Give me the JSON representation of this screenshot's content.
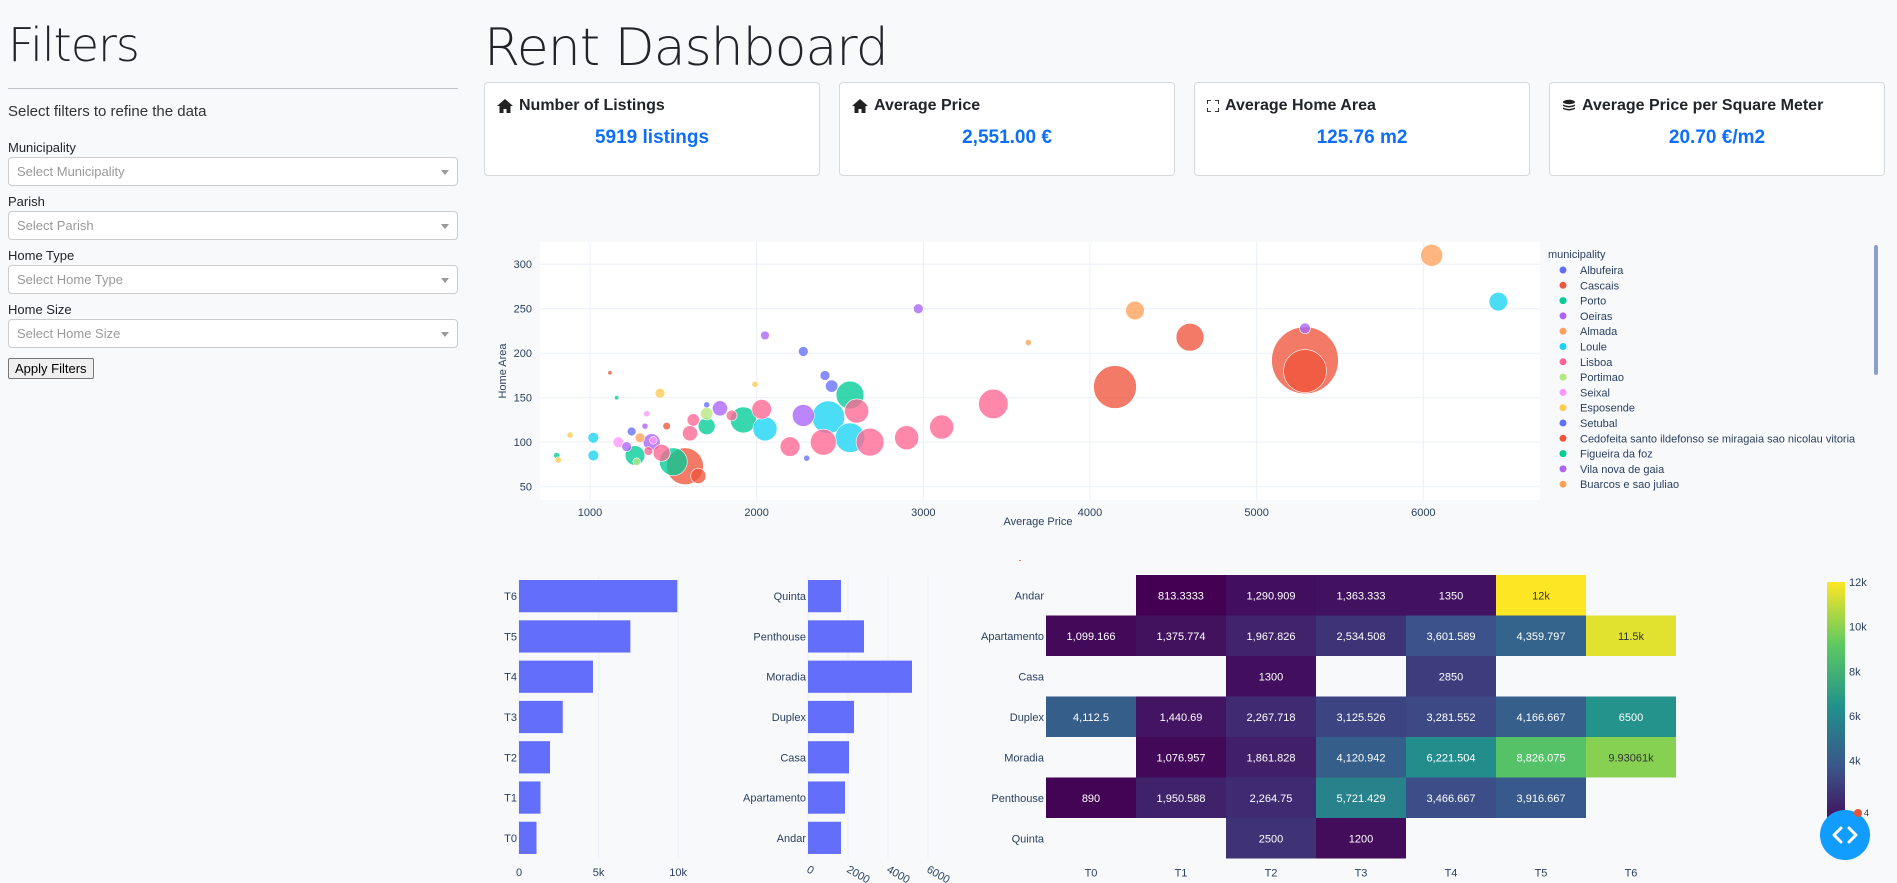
{
  "sidebar": {
    "title": "Filters",
    "subtitle": "Select filters to refine the data",
    "filters": [
      {
        "label": "Municipality",
        "placeholder": "Select Municipality"
      },
      {
        "label": "Parish",
        "placeholder": "Select Parish"
      },
      {
        "label": "Home Type",
        "placeholder": "Select Home Type"
      },
      {
        "label": "Home Size",
        "placeholder": "Select Home Size"
      }
    ],
    "apply_label": "Apply Filters"
  },
  "header": {
    "title": "Rent Dashboard"
  },
  "cards": [
    {
      "title": "Number of Listings",
      "value": "5919 listings",
      "icon": "home-icon"
    },
    {
      "title": "Average Price",
      "value": "2,551.00 €",
      "icon": "home-icon"
    },
    {
      "title": "Average Home Area",
      "value": "125.76 m2",
      "icon": "expand-icon"
    },
    {
      "title": "Average Price per Square Meter",
      "value": "20.70 €/m2",
      "icon": "coins-icon"
    }
  ],
  "colors": {
    "accent": "#0d6efd",
    "bar": "#636efa",
    "fab": "#119dff"
  },
  "chart_data": [
    {
      "type": "scatter",
      "xlabel": "Average Price",
      "ylabel": "Home Area",
      "xlim": [
        700,
        6700
      ],
      "ylim": [
        35,
        325
      ],
      "xticks": [
        1000,
        2000,
        3000,
        4000,
        5000,
        6000
      ],
      "yticks": [
        50,
        100,
        150,
        200,
        250,
        300
      ],
      "legend_title": "municipality",
      "legend_position": "right",
      "legend": [
        {
          "name": "Albufeira",
          "color": "#636efa"
        },
        {
          "name": "Cascais",
          "color": "#ef553b"
        },
        {
          "name": "Porto",
          "color": "#00cc96"
        },
        {
          "name": "Oeiras",
          "color": "#ab63fa"
        },
        {
          "name": "Almada",
          "color": "#ffa15a"
        },
        {
          "name": "Loule",
          "color": "#19d3f3"
        },
        {
          "name": "Lisboa",
          "color": "#ff6692"
        },
        {
          "name": "Portimao",
          "color": "#b6e880"
        },
        {
          "name": "Seixal",
          "color": "#ff97ff"
        },
        {
          "name": "Esposende",
          "color": "#fecb52"
        },
        {
          "name": "Setubal",
          "color": "#636efa"
        },
        {
          "name": "Cedofeita santo ildefonso se miragaia sao nicolau vitoria",
          "color": "#ef553b"
        },
        {
          "name": "Figueira da foz",
          "color": "#00cc96"
        },
        {
          "name": "Vila nova de gaia",
          "color": "#ab63fa"
        },
        {
          "name": "Buarcos e sao juliao",
          "color": "#ffa15a"
        }
      ],
      "points": [
        {
          "x": 5290,
          "y": 192,
          "count": 230,
          "color": "#ef553b"
        },
        {
          "x": 5290,
          "y": 180,
          "count": 95,
          "color": "#ef553b"
        },
        {
          "x": 4150,
          "y": 162,
          "count": 95,
          "color": "#ef553b"
        },
        {
          "x": 4600,
          "y": 218,
          "count": 40,
          "color": "#ef553b"
        },
        {
          "x": 3420,
          "y": 143,
          "count": 45,
          "color": "#ff6692"
        },
        {
          "x": 6050,
          "y": 310,
          "count": 25,
          "color": "#ffa15a"
        },
        {
          "x": 6450,
          "y": 258,
          "count": 18,
          "color": "#19d3f3"
        },
        {
          "x": 4270,
          "y": 248,
          "count": 18,
          "color": "#ffa15a"
        },
        {
          "x": 5290,
          "y": 228,
          "count": 6,
          "color": "#ab63fa"
        },
        {
          "x": 2970,
          "y": 250,
          "count": 5,
          "color": "#ab63fa"
        },
        {
          "x": 3630,
          "y": 212,
          "count": 2,
          "color": "#ffa15a"
        },
        {
          "x": 3110,
          "y": 117,
          "count": 30,
          "color": "#ff6692"
        },
        {
          "x": 2900,
          "y": 105,
          "count": 30,
          "color": "#ff6692"
        },
        {
          "x": 2680,
          "y": 100,
          "count": 40,
          "color": "#ff6692"
        },
        {
          "x": 2560,
          "y": 153,
          "count": 40,
          "color": "#00cc96"
        },
        {
          "x": 2560,
          "y": 105,
          "count": 45,
          "color": "#19d3f3"
        },
        {
          "x": 2430,
          "y": 128,
          "count": 55,
          "color": "#19d3f3"
        },
        {
          "x": 2600,
          "y": 135,
          "count": 30,
          "color": "#ff6692"
        },
        {
          "x": 2400,
          "y": 100,
          "count": 35,
          "color": "#ff6692"
        },
        {
          "x": 2280,
          "y": 130,
          "count": 25,
          "color": "#ab63fa"
        },
        {
          "x": 2200,
          "y": 95,
          "count": 20,
          "color": "#ff6692"
        },
        {
          "x": 2050,
          "y": 115,
          "count": 30,
          "color": "#19d3f3"
        },
        {
          "x": 2030,
          "y": 137,
          "count": 20,
          "color": "#ff6692"
        },
        {
          "x": 1920,
          "y": 125,
          "count": 35,
          "color": "#00cc96"
        },
        {
          "x": 2280,
          "y": 202,
          "count": 5,
          "color": "#636efa"
        },
        {
          "x": 2050,
          "y": 220,
          "count": 4,
          "color": "#ab63fa"
        },
        {
          "x": 2410,
          "y": 175,
          "count": 5,
          "color": "#636efa"
        },
        {
          "x": 2450,
          "y": 163,
          "count": 8,
          "color": "#636efa"
        },
        {
          "x": 1990,
          "y": 165,
          "count": 2,
          "color": "#fecb52"
        },
        {
          "x": 2300,
          "y": 82,
          "count": 2,
          "color": "#636efa"
        },
        {
          "x": 1570,
          "y": 73,
          "count": 70,
          "color": "#ef553b"
        },
        {
          "x": 1500,
          "y": 78,
          "count": 40,
          "color": "#00cc96"
        },
        {
          "x": 1650,
          "y": 62,
          "count": 12,
          "color": "#ef553b"
        },
        {
          "x": 1270,
          "y": 85,
          "count": 20,
          "color": "#00cc96"
        },
        {
          "x": 1370,
          "y": 100,
          "count": 15,
          "color": "#ab63fa"
        },
        {
          "x": 1430,
          "y": 88,
          "count": 15,
          "color": "#ff6692"
        },
        {
          "x": 1600,
          "y": 110,
          "count": 12,
          "color": "#ff6692"
        },
        {
          "x": 1700,
          "y": 118,
          "count": 15,
          "color": "#00cc96"
        },
        {
          "x": 1620,
          "y": 125,
          "count": 8,
          "color": "#ff6692"
        },
        {
          "x": 1780,
          "y": 138,
          "count": 12,
          "color": "#ab63fa"
        },
        {
          "x": 1700,
          "y": 132,
          "count": 8,
          "color": "#b6e880"
        },
        {
          "x": 1850,
          "y": 130,
          "count": 6,
          "color": "#ff6692"
        },
        {
          "x": 1420,
          "y": 155,
          "count": 5,
          "color": "#fecb52"
        },
        {
          "x": 1020,
          "y": 105,
          "count": 6,
          "color": "#19d3f3"
        },
        {
          "x": 1020,
          "y": 85,
          "count": 6,
          "color": "#19d3f3"
        },
        {
          "x": 1170,
          "y": 100,
          "count": 6,
          "color": "#ff97ff"
        },
        {
          "x": 1220,
          "y": 95,
          "count": 5,
          "color": "#ab63fa"
        },
        {
          "x": 1300,
          "y": 105,
          "count": 5,
          "color": "#ffa15a"
        },
        {
          "x": 1350,
          "y": 90,
          "count": 4,
          "color": "#ff6692"
        },
        {
          "x": 1250,
          "y": 112,
          "count": 4,
          "color": "#636efa"
        },
        {
          "x": 1280,
          "y": 78,
          "count": 3,
          "color": "#b6e880"
        },
        {
          "x": 880,
          "y": 108,
          "count": 2,
          "color": "#fecb52"
        },
        {
          "x": 800,
          "y": 85,
          "count": 2,
          "color": "#00cc96"
        },
        {
          "x": 810,
          "y": 80,
          "count": 2,
          "color": "#fecb52"
        },
        {
          "x": 1120,
          "y": 178,
          "count": 1,
          "color": "#ef553b"
        },
        {
          "x": 1160,
          "y": 150,
          "count": 1,
          "color": "#00cc96"
        },
        {
          "x": 1340,
          "y": 132,
          "count": 2,
          "color": "#ff97ff"
        },
        {
          "x": 1330,
          "y": 118,
          "count": 2,
          "color": "#ab63fa"
        },
        {
          "x": 1460,
          "y": 118,
          "count": 3,
          "color": "#ef553b"
        },
        {
          "x": 1380,
          "y": 102,
          "count": 3,
          "color": "#ff97ff"
        },
        {
          "x": 1700,
          "y": 142,
          "count": 2,
          "color": "#636efa"
        }
      ]
    },
    {
      "type": "bar",
      "orientation": "horizontal",
      "categories": [
        "T0",
        "T1",
        "T2",
        "T3",
        "T4",
        "T5",
        "T6"
      ],
      "values": [
        1100,
        1350,
        1950,
        2750,
        4650,
        7000,
        9950
      ],
      "xlim": [
        0,
        11000
      ],
      "xticks": [
        {
          "v": 0,
          "label": "0"
        },
        {
          "v": 5000,
          "label": "5k"
        },
        {
          "v": 10000,
          "label": "10k"
        }
      ]
    },
    {
      "type": "bar",
      "orientation": "horizontal",
      "categories": [
        "Andar",
        "Apartamento",
        "Casa",
        "Duplex",
        "Moradia",
        "Penthouse",
        "Quinta"
      ],
      "values": [
        1650,
        1850,
        2050,
        2300,
        5200,
        2800,
        1650
      ],
      "xlim": [
        0,
        7000
      ],
      "xticks": [
        {
          "v": 0,
          "label": "0"
        },
        {
          "v": 2000,
          "label": "2000"
        },
        {
          "v": 4000,
          "label": "4000"
        },
        {
          "v": 6000,
          "label": "6000"
        }
      ]
    },
    {
      "type": "heatmap",
      "x": [
        "T0",
        "T1",
        "T2",
        "T3",
        "T4",
        "T5",
        "T6"
      ],
      "y": [
        "Andar",
        "Apartamento",
        "Casa",
        "Duplex",
        "Moradia",
        "Penthouse",
        "Quinta"
      ],
      "colorscale": "Viridis",
      "zmin": 800,
      "zmax": 12000,
      "colorbar_ticks": [
        {
          "v": 4000,
          "label": "4k"
        },
        {
          "v": 6000,
          "label": "6k"
        },
        {
          "v": 8000,
          "label": "8k"
        },
        {
          "v": 10000,
          "label": "10k"
        },
        {
          "v": 12000,
          "label": "12k"
        }
      ],
      "cells": [
        [
          null,
          {
            "z": 813.3333,
            "text": "813.3333"
          },
          {
            "z": 1290.909,
            "text": "1,290.909"
          },
          {
            "z": 1363.333,
            "text": "1,363.333"
          },
          {
            "z": 1350,
            "text": "1350"
          },
          {
            "z": 12000,
            "text": "12k"
          },
          null
        ],
        [
          {
            "z": 1099.166,
            "text": "1,099.166"
          },
          {
            "z": 1375.774,
            "text": "1,375.774"
          },
          {
            "z": 1967.826,
            "text": "1,967.826"
          },
          {
            "z": 2534.508,
            "text": "2,534.508"
          },
          {
            "z": 3601.589,
            "text": "3,601.589"
          },
          {
            "z": 4359.797,
            "text": "4,359.797"
          },
          {
            "z": 11500,
            "text": "11.5k"
          }
        ],
        [
          null,
          null,
          {
            "z": 1300,
            "text": "1300"
          },
          null,
          {
            "z": 2850,
            "text": "2850"
          },
          null,
          null
        ],
        [
          {
            "z": 4112.5,
            "text": "4,112.5"
          },
          {
            "z": 1440.69,
            "text": "1,440.69"
          },
          {
            "z": 2267.718,
            "text": "2,267.718"
          },
          {
            "z": 3125.526,
            "text": "3,125.526"
          },
          {
            "z": 3281.552,
            "text": "3,281.552"
          },
          {
            "z": 4166.667,
            "text": "4,166.667"
          },
          {
            "z": 6500,
            "text": "6500"
          }
        ],
        [
          null,
          {
            "z": 1076.957,
            "text": "1,076.957"
          },
          {
            "z": 1861.828,
            "text": "1,861.828"
          },
          {
            "z": 4120.942,
            "text": "4,120.942"
          },
          {
            "z": 6221.504,
            "text": "6,221.504"
          },
          {
            "z": 8826.075,
            "text": "8,826.075"
          },
          {
            "z": 9930.61,
            "text": "9.93061k"
          }
        ],
        [
          {
            "z": 890,
            "text": "890"
          },
          {
            "z": 1950.588,
            "text": "1,950.588"
          },
          {
            "z": 2264.75,
            "text": "2,264.75"
          },
          {
            "z": 5721.429,
            "text": "5,721.429"
          },
          {
            "z": 3466.667,
            "text": "3,466.667"
          },
          {
            "z": 3916.667,
            "text": "3,916.667"
          },
          null
        ],
        [
          null,
          null,
          {
            "z": 2500,
            "text": "2500"
          },
          {
            "z": 1200,
            "text": "1200"
          },
          null,
          null,
          null
        ]
      ]
    }
  ],
  "fab": {
    "icon": "code-icon",
    "badge": "4"
  }
}
